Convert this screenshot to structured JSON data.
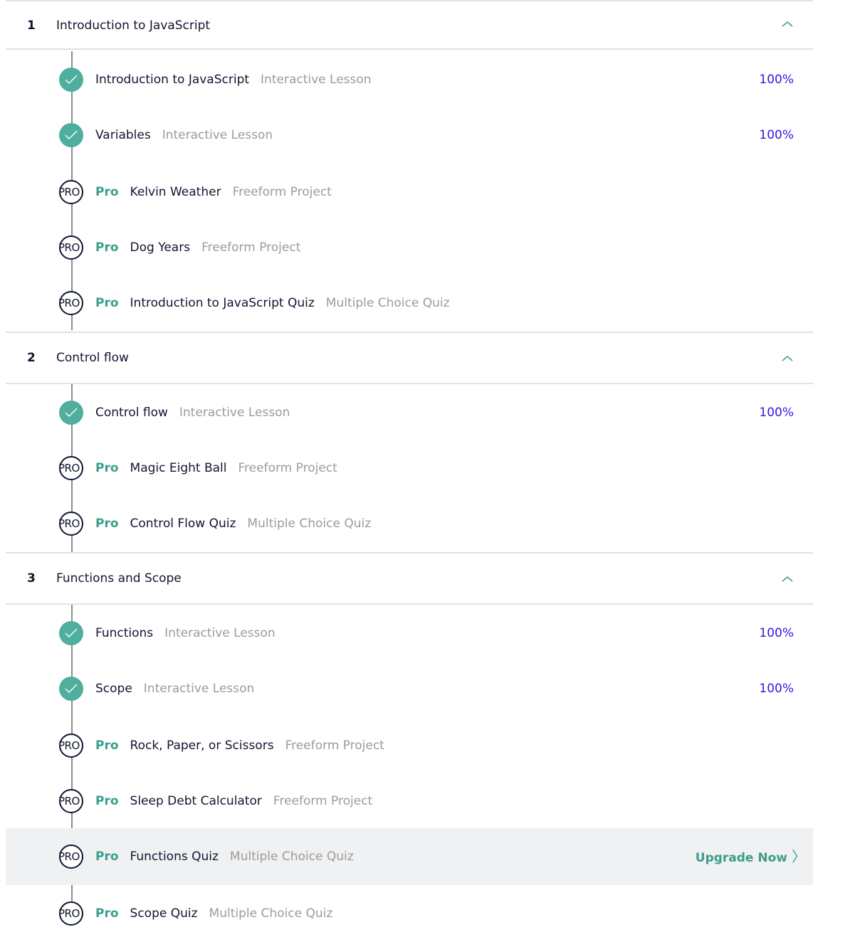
{
  "colors": {
    "accent_teal": "#4fae9d",
    "pro_green": "#3a9e8c",
    "percent_purple": "#3a10e5",
    "muted_gray": "#9b9b9b",
    "text_dark": "#10162f",
    "highlight_bg": "#f0f1f3"
  },
  "pro_badge_text": "PRO",
  "pro_label": "Pro",
  "upgrade_label": "Upgrade Now",
  "upgrade_chevron": "〉",
  "modules": [
    {
      "number": "1",
      "title": "Introduction to JavaScript",
      "icon": "chevron-up-icon",
      "items": [
        {
          "title": "Introduction to JavaScript",
          "type": "Interactive Lesson",
          "status": "completed",
          "progress": "100%"
        },
        {
          "title": "Variables",
          "type": "Interactive Lesson",
          "status": "completed",
          "progress": "100%"
        },
        {
          "title": "Kelvin Weather",
          "type": "Freeform Project",
          "status": "pro"
        },
        {
          "title": "Dog Years",
          "type": "Freeform Project",
          "status": "pro"
        },
        {
          "title": "Introduction to JavaScript Quiz",
          "type": "Multiple Choice Quiz",
          "status": "pro"
        }
      ]
    },
    {
      "number": "2",
      "title": "Control flow",
      "icon": "chevron-up-icon",
      "items": [
        {
          "title": "Control flow",
          "type": "Interactive Lesson",
          "status": "completed",
          "progress": "100%"
        },
        {
          "title": "Magic Eight Ball",
          "type": "Freeform Project",
          "status": "pro"
        },
        {
          "title": "Control Flow Quiz",
          "type": "Multiple Choice Quiz",
          "status": "pro"
        }
      ]
    },
    {
      "number": "3",
      "title": "Functions and Scope",
      "icon": "chevron-up-icon",
      "items": [
        {
          "title": "Functions",
          "type": "Interactive Lesson",
          "status": "completed",
          "progress": "100%"
        },
        {
          "title": "Scope",
          "type": "Interactive Lesson",
          "status": "completed",
          "progress": "100%"
        },
        {
          "title": "Rock, Paper, or Scissors",
          "type": "Freeform Project",
          "status": "pro"
        },
        {
          "title": "Sleep Debt Calculator",
          "type": "Freeform Project",
          "status": "pro"
        },
        {
          "title": "Functions Quiz",
          "type": "Multiple Choice Quiz",
          "status": "pro",
          "hovered": true
        },
        {
          "title": "Scope Quiz",
          "type": "Multiple Choice Quiz",
          "status": "pro"
        }
      ]
    }
  ]
}
